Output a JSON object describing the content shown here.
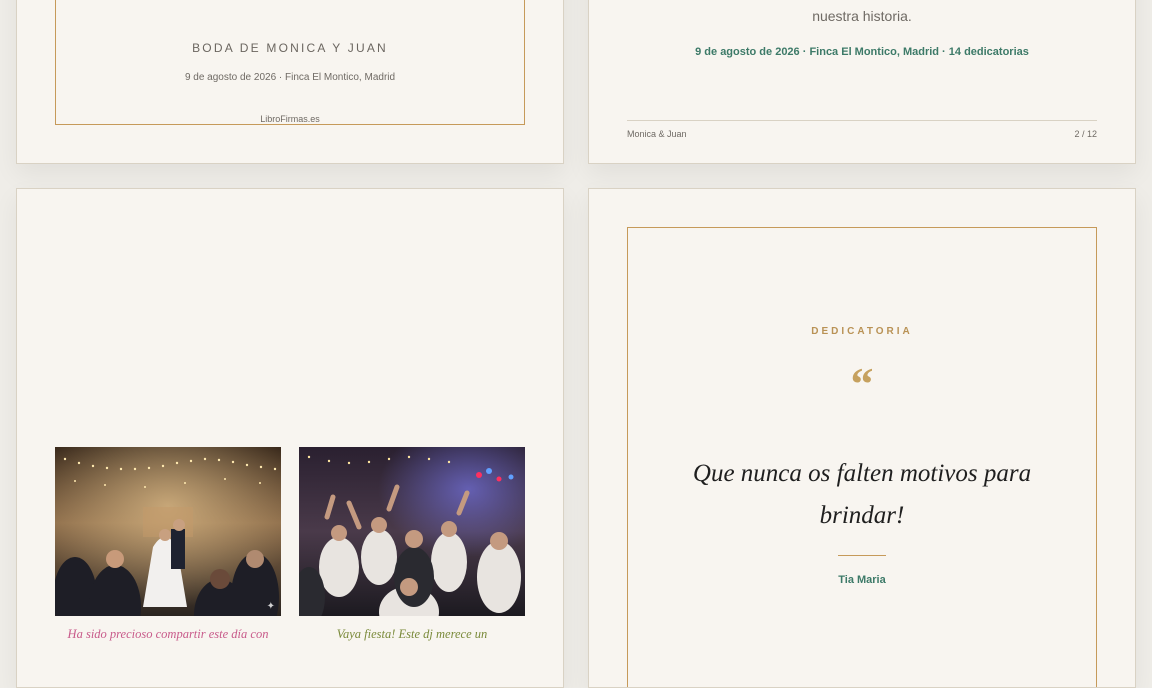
{
  "cover": {
    "title": "BODA DE MONICA Y JUAN",
    "date_place": "9 de agosto de 2026 · Finca El Montico, Madrid",
    "brand": "LibroFirmas.es"
  },
  "intro": {
    "text_tail": "nuestra historia.",
    "meta": "9 de agosto de 2026 · Finca El Montico, Madrid · 14 dedicatorias",
    "footer_left": "Monica & Juan",
    "footer_right": "2 / 12"
  },
  "photos": {
    "caption_1": "Ha sido precioso compartir este día con",
    "caption_2": "Vaya fiesta! Este dj merece un"
  },
  "dedication": {
    "label": "DEDICATORIA",
    "quote_mark": "“",
    "text": "Que nunca os falten motivos para brindar!",
    "author": "Tia Maria"
  },
  "colors": {
    "accent_gold": "#c69a5a",
    "accent_green": "#3d7a68",
    "page_bg": "#f8f5f0"
  }
}
